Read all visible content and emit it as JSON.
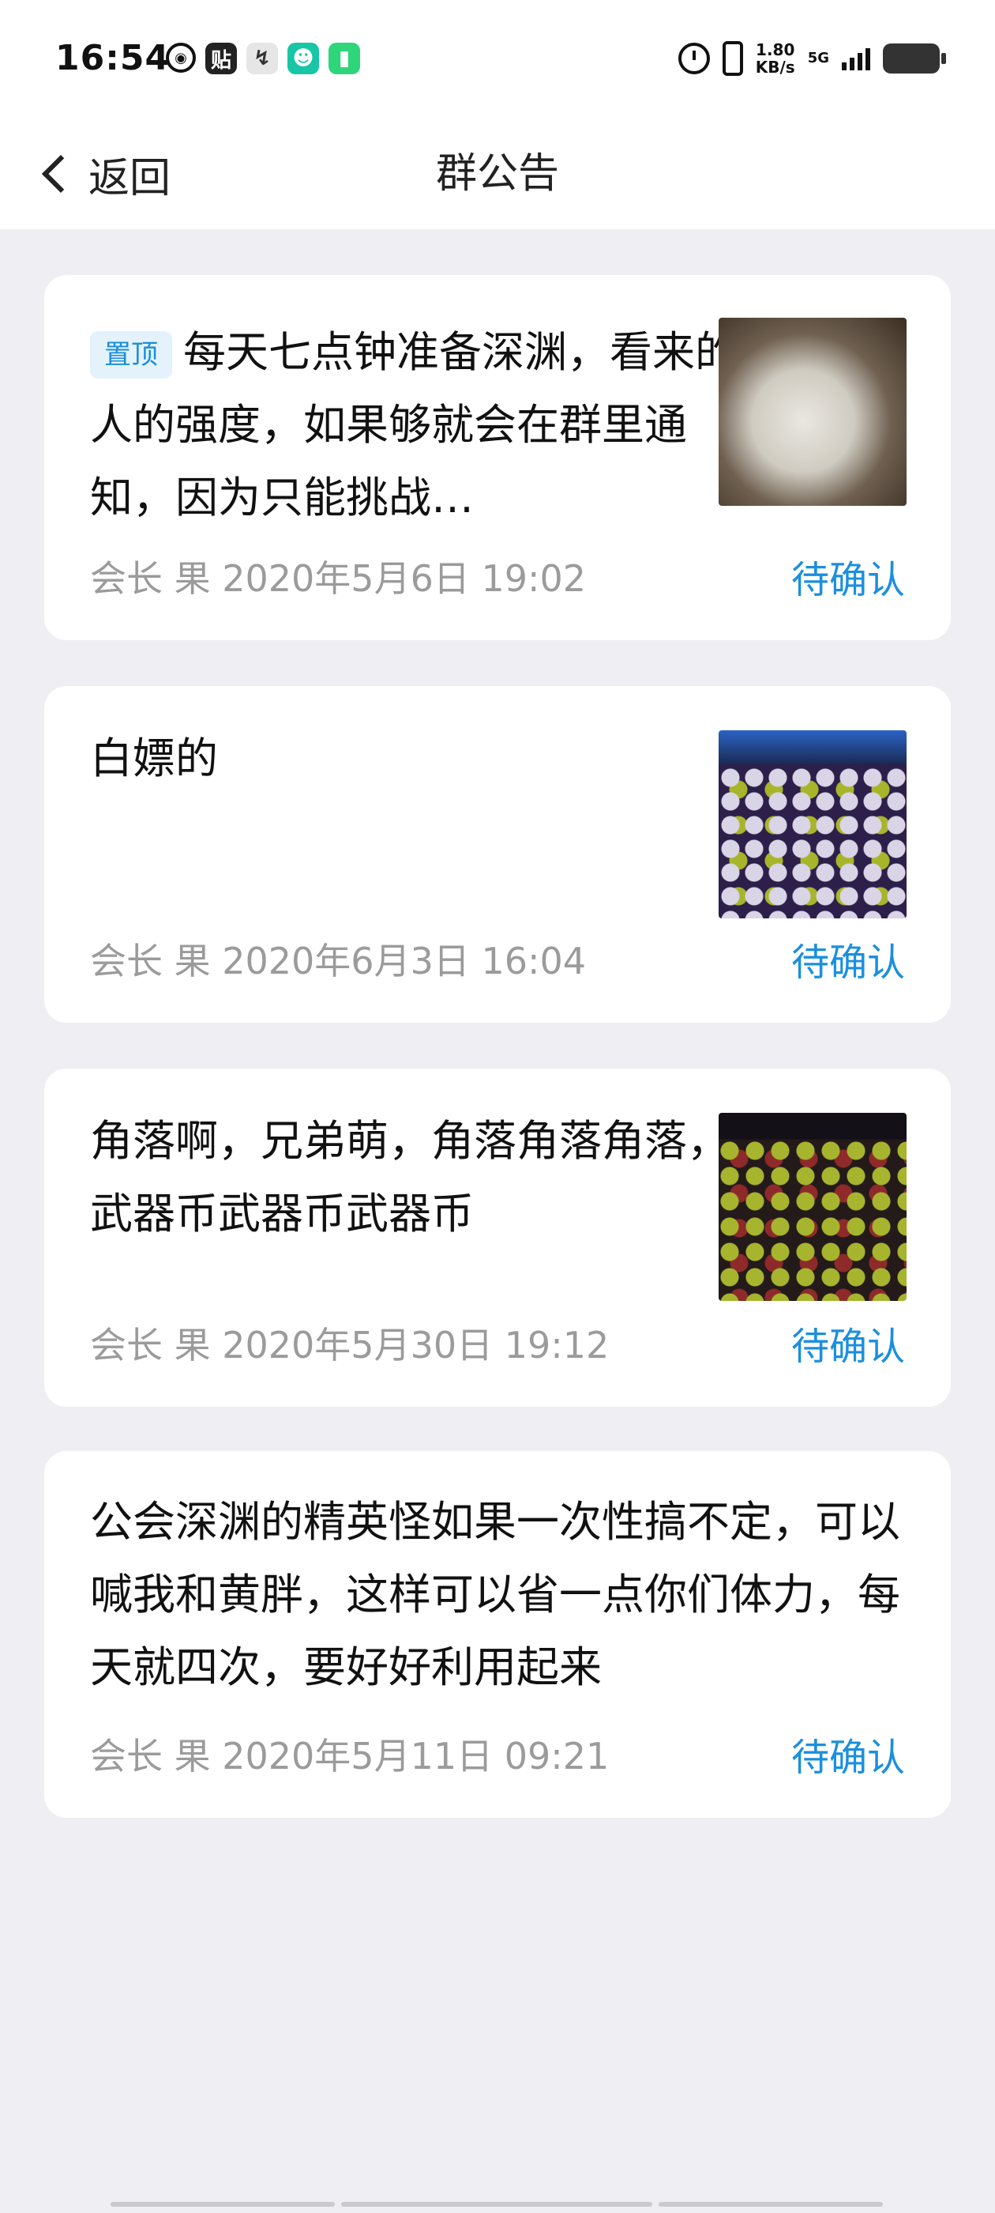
{
  "status_bar": {
    "time": "16:54",
    "speed_value": "1.80",
    "speed_unit": "KB/s",
    "network": "5G"
  },
  "header": {
    "back_label": "返回",
    "title": "群公告"
  },
  "announcements": [
    {
      "pinned_label": "置顶",
      "text": "每天七点钟准备深渊，看来的人的强度，如果够就会在群里通知，因为只能挑战…",
      "meta": "会长 果 2020年5月6日 19:02",
      "action": "待确认",
      "has_image": true
    },
    {
      "text": "白嫖的",
      "meta": "会长 果 2020年6月3日 16:04",
      "action": "待确认",
      "has_image": true
    },
    {
      "text": "角落啊，兄弟萌，角落角落角落，武器币武器币武器币",
      "meta": "会长 果 2020年5月30日 19:12",
      "action": "待确认",
      "has_image": true
    },
    {
      "text": "公会深渊的精英怪如果一次性搞不定，可以喊我和黄胖，这样可以省一点你们体力，每天就四次，要好好利用起来",
      "meta": "会长 果 2020年5月11日 09:21",
      "action": "待确认",
      "has_image": false
    }
  ],
  "colors": {
    "accent": "#1b8fde",
    "page_bg": "#eeeef3",
    "card_bg": "#ffffff",
    "meta_text": "#9b9b9b",
    "pin_bg": "#e3f2fb"
  }
}
